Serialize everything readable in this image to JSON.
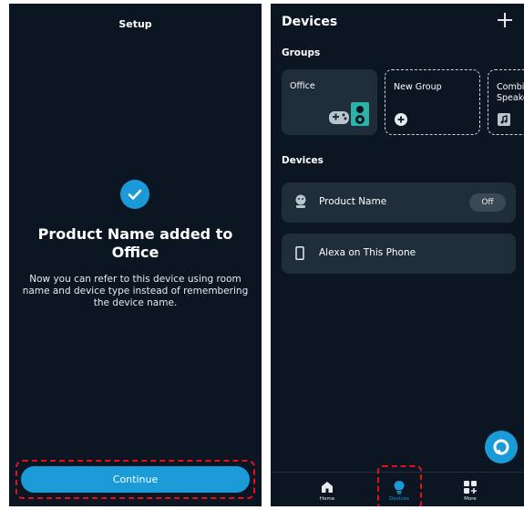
{
  "colors": {
    "background": "#0b1622",
    "card": "#1f2c39",
    "accent": "#1a9bd7",
    "highlight": "#e3111b"
  },
  "setup_screen": {
    "title": "Setup",
    "heading": "Product  Name added to\nOffice",
    "description": "Now you can refer to this device using room name and device type instead of remembering the device name.",
    "continue_label": "Continue",
    "icon": "check-icon"
  },
  "devices_screen": {
    "title": "Devices",
    "add_icon": "plus-icon",
    "groups_label": "Groups",
    "groups": [
      {
        "label": "Office",
        "icon": "game-controller-speaker-icon"
      },
      {
        "label": "New Group",
        "icon": "plus-circle-icon"
      },
      {
        "label": "Combi\nSpeake",
        "icon": "speaker-music-icon"
      }
    ],
    "devices_label": "Devices",
    "devices": [
      {
        "label": "Product  Name",
        "state": "Off",
        "icon": "smart-plug-icon"
      },
      {
        "label": "Alexa on This Phone",
        "icon": "phone-icon"
      }
    ],
    "nav": [
      {
        "label": "Home",
        "icon": "home-icon"
      },
      {
        "label": "Devices",
        "icon": "lightbulb-icon",
        "active": true
      },
      {
        "label": "More",
        "icon": "grid-plus-icon"
      }
    ]
  }
}
